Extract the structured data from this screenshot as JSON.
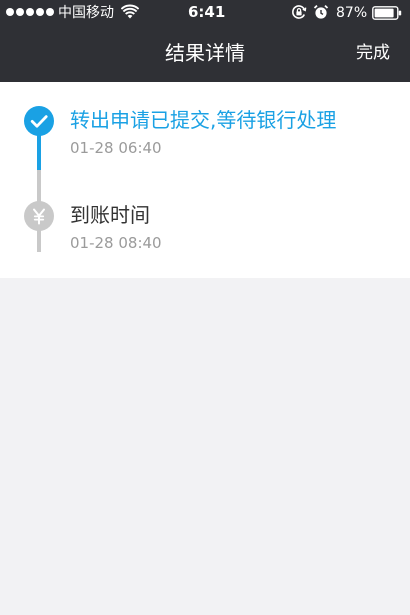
{
  "status_bar": {
    "carrier": "中国移动",
    "time": "6:41",
    "battery_pct": "87%"
  },
  "nav": {
    "title": "结果详情",
    "done_label": "完成"
  },
  "timeline": [
    {
      "title": "转出申请已提交,等待银行处理",
      "time": "01-28 06:40",
      "status": "completed",
      "icon": "check-icon"
    },
    {
      "title": "到账时间",
      "time": "01-28 08:40",
      "status": "pending",
      "icon": "yen-icon"
    }
  ],
  "colors": {
    "header_bg": "#2f3035",
    "accent": "#1aa1e4",
    "pending": "#c9c9c9",
    "page_bg": "#f2f2f4"
  }
}
